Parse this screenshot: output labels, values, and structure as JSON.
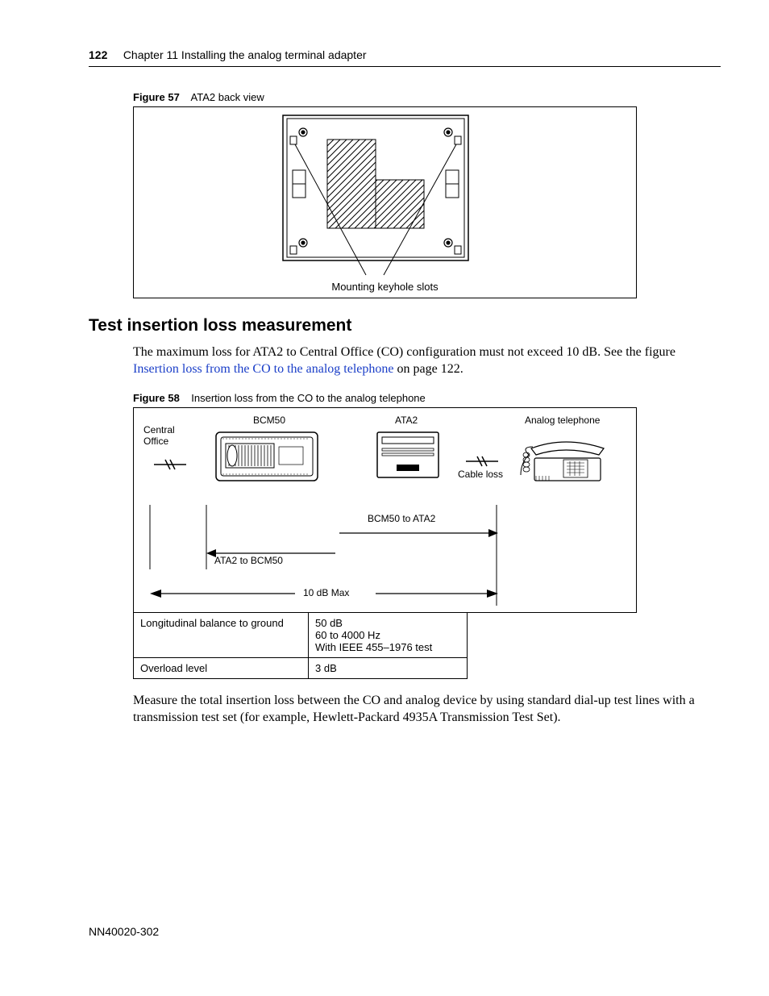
{
  "header": {
    "page_number": "122",
    "chapter_text": "Chapter 11  Installing the analog terminal adapter"
  },
  "figure57": {
    "caption_label": "Figure 57",
    "caption_text": "ATA2 back view",
    "callout": "Mounting keyhole slots"
  },
  "section": {
    "heading": "Test insertion loss measurement",
    "para1_a": "The maximum loss for ATA2 to Central Office (CO) configuration must not exceed 10 dB. See the figure ",
    "para1_link": "Insertion loss from the CO to the analog telephone",
    "para1_b": " on page 122."
  },
  "figure58": {
    "caption_label": "Figure 58",
    "caption_text": "Insertion loss from the CO to the analog telephone",
    "labels": {
      "central_office": "Central\nOffice",
      "bcm50": "BCM50",
      "ata2": "ATA2",
      "analog_phone": "Analog telephone",
      "cable_loss": "Cable loss",
      "bcm50_to_ata2": "BCM50 to ATA2",
      "ata2_to_bcm50": "ATA2 to BCM50",
      "max_loss": "10 dB Max"
    }
  },
  "spec_table": {
    "rows": [
      {
        "k": "Longitudinal balance to ground",
        "v": "50 dB\n60 to 4000 Hz\nWith IEEE 455–1976 test"
      },
      {
        "k": "Overload level",
        "v": "3 dB"
      }
    ]
  },
  "para2": "Measure the total insertion loss between the CO and analog device by using standard dial-up test lines with a transmission test set (for example, Hewlett-Packard 4935A Transmission Test Set).",
  "footer": {
    "doc_id": "NN40020-302"
  }
}
